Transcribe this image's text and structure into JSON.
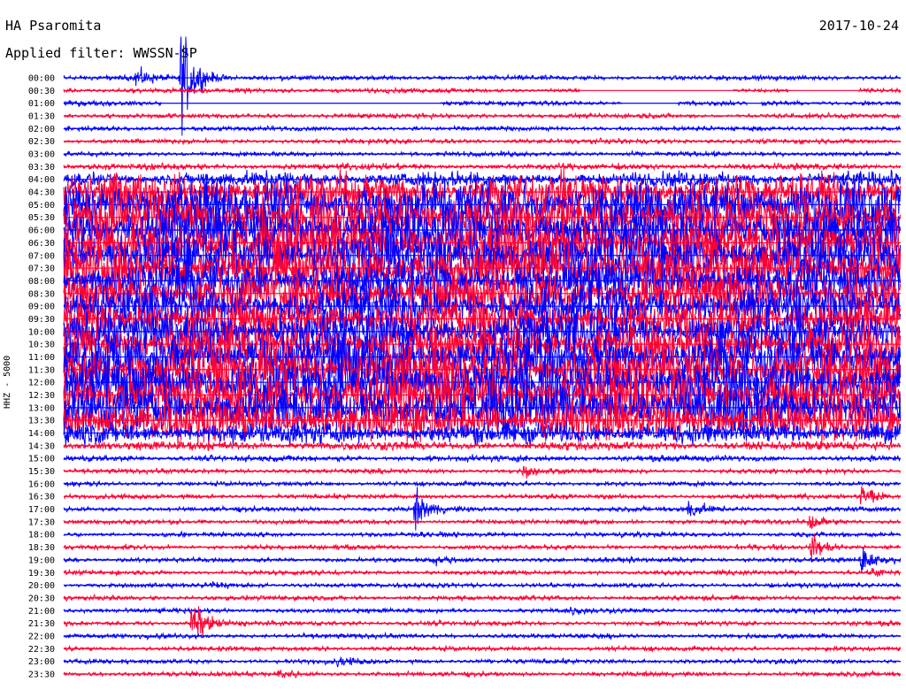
{
  "header": {
    "station": "HA Psaromita",
    "filter": "Applied filter: WWSSN-SP",
    "date": "2017-10-24"
  },
  "chart_data": {
    "type": "line",
    "subtype": "helicorder",
    "ylabel": "HHZ - 5000",
    "row_labels": [
      "00:00",
      "00:30",
      "01:00",
      "01:30",
      "02:00",
      "02:30",
      "03:00",
      "03:30",
      "04:00",
      "04:30",
      "05:00",
      "05:30",
      "06:00",
      "06:30",
      "07:00",
      "07:30",
      "08:00",
      "08:30",
      "09:00",
      "09:30",
      "10:00",
      "10:30",
      "11:00",
      "11:30",
      "12:00",
      "12:30",
      "13:00",
      "13:30",
      "14:00",
      "14:30",
      "15:00",
      "15:30",
      "16:00",
      "16:30",
      "17:00",
      "17:30",
      "18:00",
      "18:30",
      "19:00",
      "19:30",
      "20:00",
      "20:30",
      "21:00",
      "21:30",
      "22:00",
      "22:30",
      "23:00",
      "23:30"
    ],
    "row_minutes": 30,
    "colors": [
      "#0000ff",
      "#ff0033"
    ],
    "noise_envelope": [
      0.3,
      0.3,
      0.3,
      0.3,
      0.3,
      0.3,
      0.3,
      0.4,
      1.0,
      2.5,
      3.5,
      3.5,
      3.5,
      3.5,
      3.5,
      3.5,
      3.0,
      3.0,
      3.0,
      3.0,
      3.0,
      3.0,
      3.5,
      3.5,
      3.5,
      3.5,
      3.5,
      3.0,
      1.5,
      0.6,
      0.4,
      0.3,
      0.3,
      0.3,
      0.3,
      0.3,
      0.3,
      0.3,
      0.3,
      0.3,
      0.3,
      0.3,
      0.3,
      0.3,
      0.3,
      0.3,
      0.3,
      0.3
    ],
    "gaps": [
      {
        "row": 1,
        "x_min": [
          18.5,
          24.0
        ]
      },
      {
        "row": 1,
        "x_min": [
          26.0,
          28.5
        ]
      },
      {
        "row": 2,
        "x_min": [
          3.5,
          13.5
        ]
      },
      {
        "row": 2,
        "x_min": [
          20.0,
          22.0
        ]
      },
      {
        "row": 2,
        "x_min": [
          24.5,
          25.0
        ]
      },
      {
        "row": 2,
        "x_min": [
          21.0,
          22.0
        ]
      }
    ],
    "events": [
      {
        "row": 0,
        "x_min": 2.6,
        "amp": 1.4
      },
      {
        "row": 0,
        "x_min": 4.2,
        "amp": 7.0
      },
      {
        "row": 2,
        "x_min": 4.2,
        "amp": 3.0
      },
      {
        "row": 31,
        "x_min": 16.5,
        "amp": 0.9
      },
      {
        "row": 33,
        "x_min": 28.6,
        "amp": 2.2
      },
      {
        "row": 34,
        "x_min": 12.6,
        "amp": 2.4
      },
      {
        "row": 34,
        "x_min": 22.4,
        "amp": 1.4
      },
      {
        "row": 35,
        "x_min": 26.7,
        "amp": 1.4
      },
      {
        "row": 37,
        "x_min": 26.8,
        "amp": 2.0
      },
      {
        "row": 38,
        "x_min": 28.6,
        "amp": 1.6
      },
      {
        "row": 38,
        "x_min": 13.2,
        "amp": 0.5
      },
      {
        "row": 39,
        "x_min": 29.0,
        "amp": 0.6
      },
      {
        "row": 40,
        "x_min": 5.3,
        "amp": 0.6
      },
      {
        "row": 42,
        "x_min": 18.0,
        "amp": 0.5
      },
      {
        "row": 43,
        "x_min": 4.6,
        "amp": 3.0
      },
      {
        "row": 46,
        "x_min": 9.8,
        "amp": 0.5
      },
      {
        "row": 47,
        "x_min": 7.7,
        "amp": 0.7
      }
    ]
  }
}
